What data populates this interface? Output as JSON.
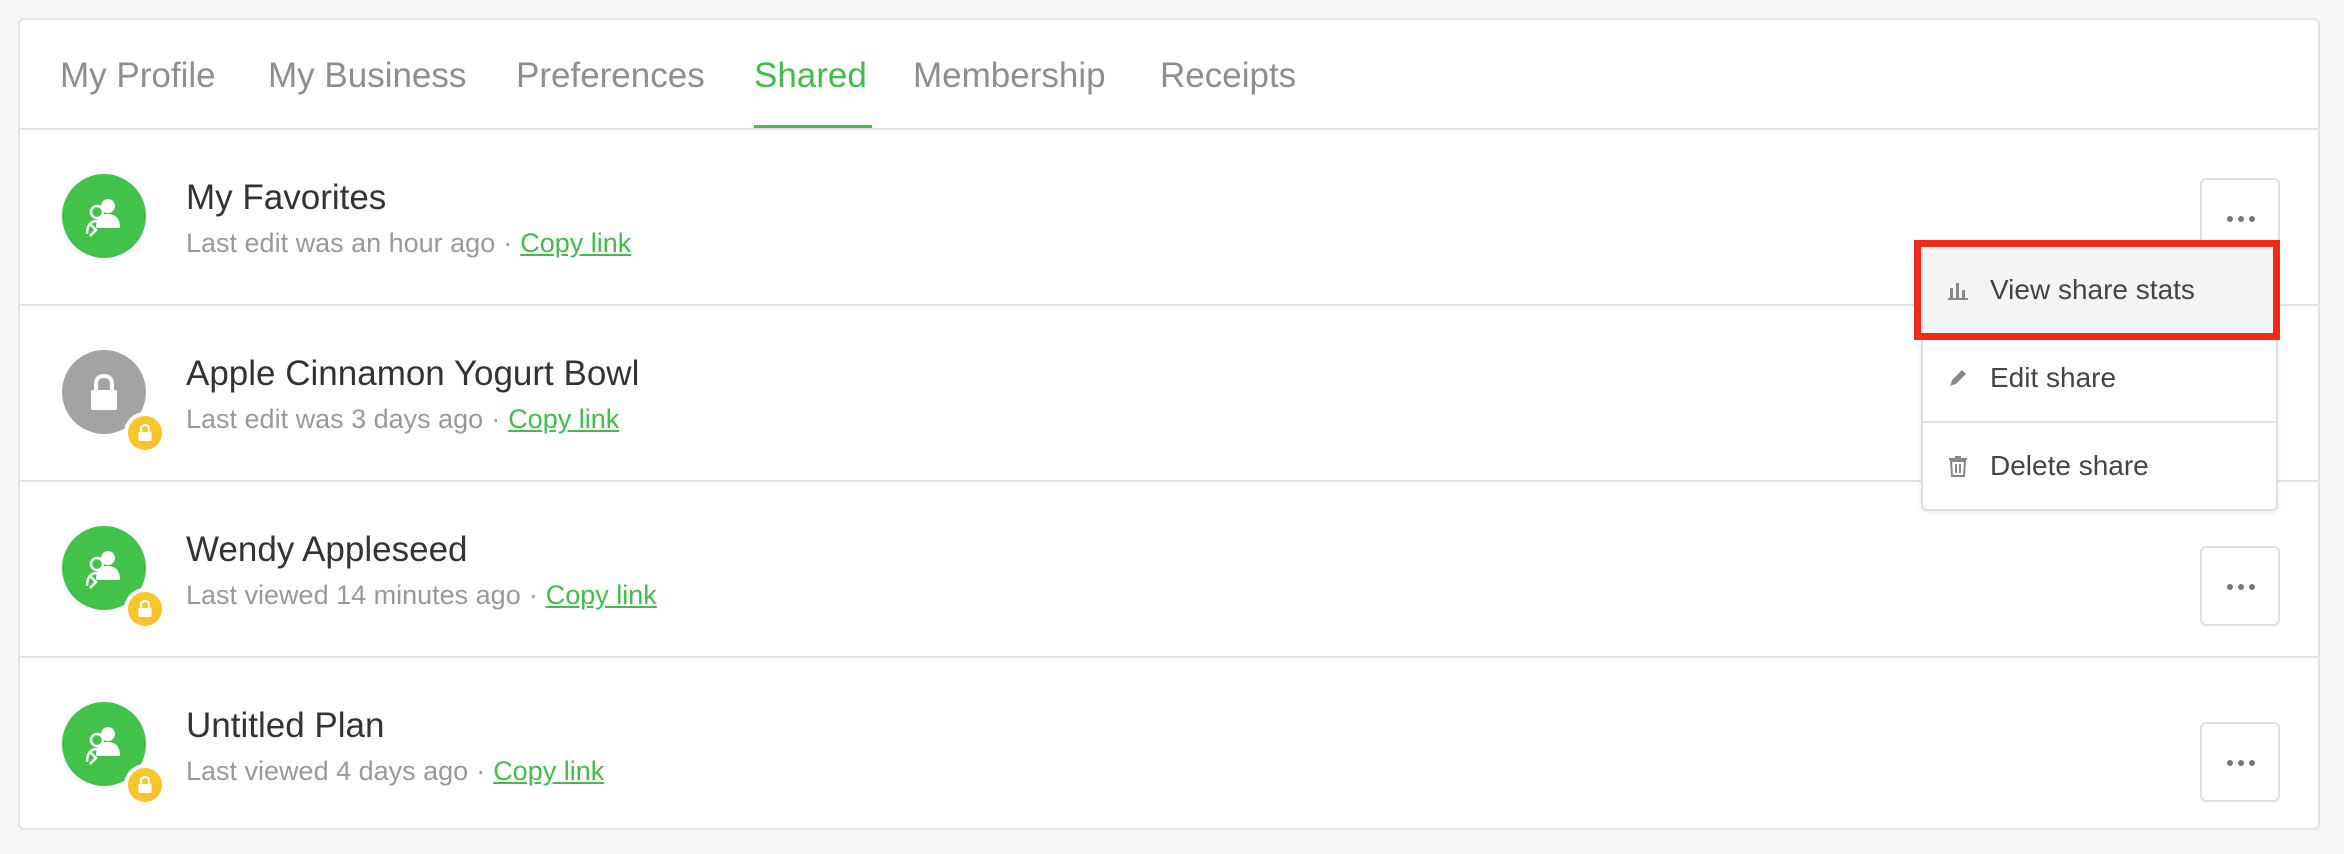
{
  "tabs": [
    {
      "label": "My Profile"
    },
    {
      "label": "My Business"
    },
    {
      "label": "Preferences"
    },
    {
      "label": "Shared"
    },
    {
      "label": "Membership"
    },
    {
      "label": "Receipts"
    }
  ],
  "active_tab": "Shared",
  "shares": [
    {
      "title": "My Favorites",
      "subtitle": "Last edit was an hour ago",
      "separator": "·",
      "link": "Copy link",
      "avatar": "people-icon",
      "locked": false
    },
    {
      "title": "Apple Cinnamon Yogurt Bowl",
      "subtitle": "Last edit was 3 days ago",
      "separator": "·",
      "link": "Copy link",
      "avatar": "lock-icon",
      "locked": true
    },
    {
      "title": "Wendy Appleseed",
      "subtitle": "Last viewed 14 minutes ago",
      "separator": "·",
      "link": "Copy link",
      "avatar": "people-icon",
      "locked": true
    },
    {
      "title": "Untitled Plan",
      "subtitle": "Last viewed 4 days ago",
      "separator": "·",
      "link": "Copy link",
      "avatar": "people-icon",
      "locked": true
    }
  ],
  "menu": {
    "items": [
      {
        "label": "View share stats",
        "icon": "bar-chart-icon"
      },
      {
        "label": "Edit share",
        "icon": "pencil-icon"
      },
      {
        "label": "Delete share",
        "icon": "trash-icon"
      }
    ]
  },
  "colors": {
    "accent": "#3fbe4a",
    "avatar_green": "#43c24a",
    "avatar_gray": "#a3a3a3",
    "badge_yellow": "#f7c52a",
    "highlight_red": "#ee2a1b"
  }
}
